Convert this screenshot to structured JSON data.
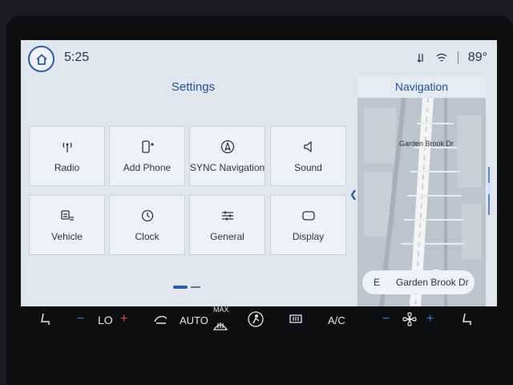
{
  "status": {
    "time": "5:25",
    "temperature": "89°"
  },
  "settings": {
    "title": "Settings",
    "tiles": [
      {
        "label": "Radio",
        "icon": "antenna-icon"
      },
      {
        "label": "Add Phone",
        "icon": "phone-add-icon"
      },
      {
        "label": "SYNC Navigation",
        "icon": "navigation-icon"
      },
      {
        "label": "Sound",
        "icon": "speaker-icon"
      },
      {
        "label": "Vehicle",
        "icon": "vehicle-icon"
      },
      {
        "label": "Clock",
        "icon": "clock-icon"
      },
      {
        "label": "General",
        "icon": "sliders-icon"
      },
      {
        "label": "Display",
        "icon": "display-icon"
      }
    ]
  },
  "navigation": {
    "title": "Navigation",
    "street_label": "Garden Brook Dr",
    "destination": {
      "direction": "E",
      "street": "Garden Brook Dr"
    }
  },
  "climate": {
    "left_temp": "LO",
    "auto": "AUTO",
    "max": "MAX",
    "ac": "A/C",
    "minus": "−",
    "plus": "+"
  },
  "colors": {
    "accent": "#2a5aa8",
    "screen_bg": "#dfe6ee",
    "tile_bg": "#eef2f7",
    "bezel": "#0d0e10",
    "heat_red": "#e04848",
    "fan_blue": "#3a7be0"
  }
}
